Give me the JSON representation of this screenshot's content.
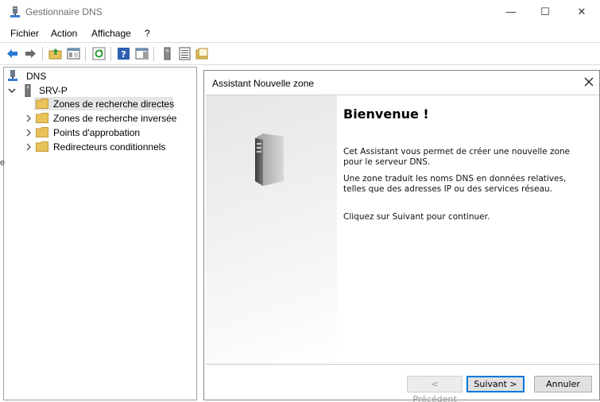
{
  "window": {
    "title": "Gestionnaire DNS",
    "min_glyph": "—",
    "max_glyph": "☐",
    "close_glyph": "✕"
  },
  "menu": {
    "items": [
      "Fichier",
      "Action",
      "Affichage",
      "?"
    ]
  },
  "toolbar": {
    "icons": [
      "back-arrow-icon",
      "forward-arrow-icon",
      "up-folder-icon",
      "show-hide-tree-icon",
      "refresh-icon",
      "help-icon",
      "action-pane-icon",
      "server-icon",
      "list-icon",
      "folder-icon"
    ]
  },
  "tree": {
    "root": "DNS",
    "server": "SRV-P",
    "items": [
      {
        "label": "Zones de recherche directes",
        "selected": true
      },
      {
        "label": "Zones de recherche inversée",
        "selected": false
      },
      {
        "label": "Points d'approbation",
        "selected": false
      },
      {
        "label": "Redirecteurs conditionnels",
        "selected": false
      }
    ]
  },
  "dialog": {
    "title": "Assistant Nouvelle zone",
    "close_glyph": "✕",
    "heading": "Bienvenue !",
    "paragraph1": "Cet Assistant vous permet de créer une nouvelle zone pour le serveur DNS.",
    "paragraph2": "Une zone traduit les noms DNS en données relatives, telles que des adresses IP ou des services réseau.",
    "paragraph3": "Cliquez sur Suivant pour continuer.",
    "buttons": {
      "previous": "< Précédent",
      "next": "Suivant >",
      "cancel": "Annuler"
    }
  },
  "edge_fragment": "e",
  "colors": {
    "accent": "#0078d7",
    "selection": "#e5e5e5",
    "folder": "#e8c25a"
  }
}
